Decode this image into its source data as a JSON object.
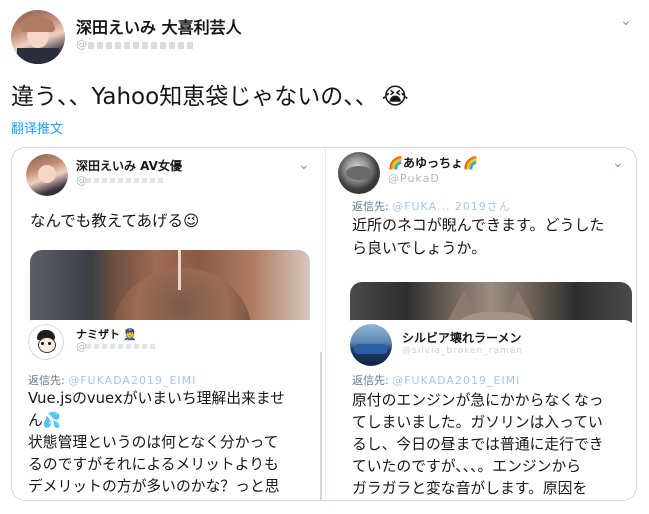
{
  "main_tweet": {
    "name": "深田えいみ 大喜利芸人",
    "handle": "@",
    "text": "違う、、Yahoo知恵袋じゃないの、、",
    "emoji": "😭",
    "translate": "翻译推文"
  },
  "left_tweet": {
    "name": "深田えいみ AV女優",
    "handle": "@",
    "text": "なんでも教えてあげる😉"
  },
  "left_reply": {
    "name": "ナミザト",
    "name_emoji": "👮",
    "handle": "@",
    "reply_label": "返信先:",
    "reply_handle": "@FUKADA2019_EIMI",
    "text_lines": [
      "Vue.jsのvuexがいまいち理解出来ませ",
      "ん💦",
      "状態管理というのは何となく分かって",
      "るのですがそれによるメリットよりも",
      "デメリットの方が多いのかな？っと思"
    ]
  },
  "right_tweet": {
    "name": "🌈あゆっちょ🌈",
    "handle": "@PukaD",
    "reply_label": "返信先:",
    "reply_handle": "@FUKA... 2019さん",
    "text_lines": [
      "近所のネコが睨んできます。どうした",
      "ら良いでしょうか。"
    ]
  },
  "right_reply": {
    "name": "シルビア壊れラーメン",
    "handle": "@silvia_broken_ramen",
    "reply_label": "返信先:",
    "reply_handle": "@FUKADA2019_EIMI",
    "text_lines": [
      "原付のエンジンが急にかからなくなっ",
      "てしまいました。ガソリンは入ってい",
      "るし、今日の昼までは普通に走行でき",
      "ていたのですが、、、。エンジンから",
      "ガラガラと変な音がします。原因を"
    ]
  }
}
